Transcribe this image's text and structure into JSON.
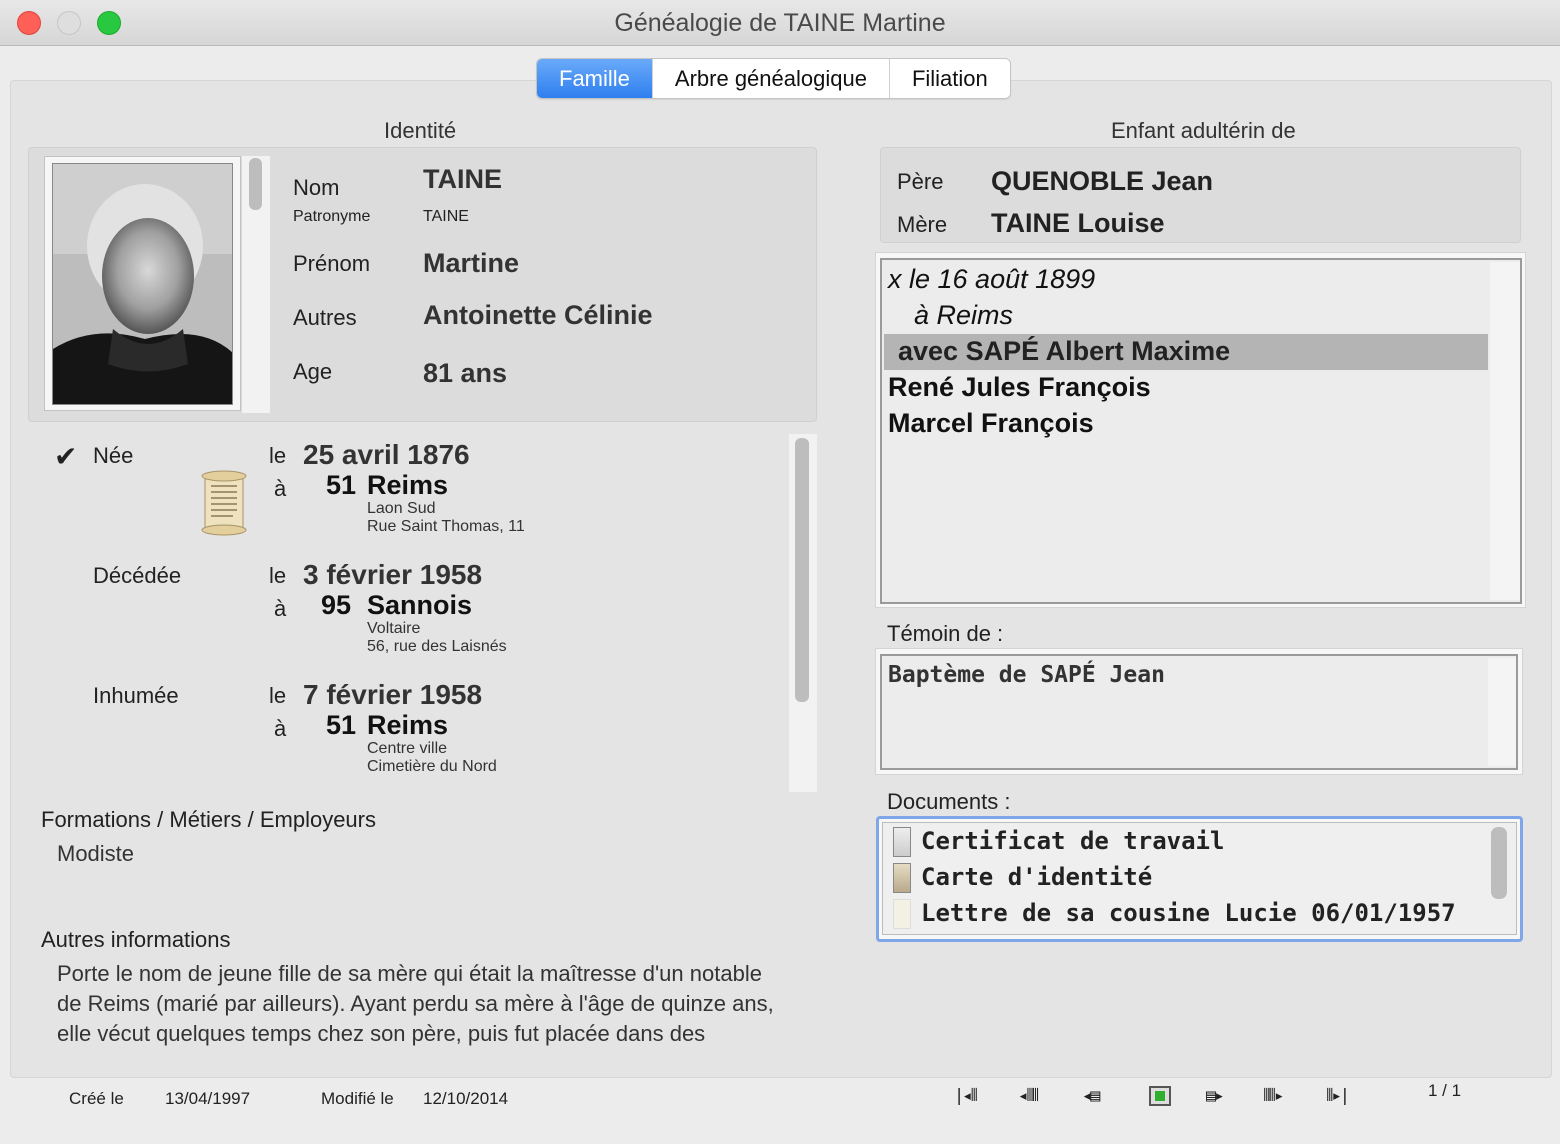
{
  "window": {
    "title": "Généalogie de TAINE Martine",
    "colors": {
      "close": "#fe5f57",
      "minimize": "#dedede",
      "zoom": "#28c840"
    }
  },
  "tabs": [
    {
      "label": "Famille",
      "active": true
    },
    {
      "label": "Arbre généalogique",
      "active": false
    },
    {
      "label": "Filiation",
      "active": false
    }
  ],
  "identity": {
    "heading": "Identité",
    "nom_label": "Nom",
    "nom_value": "TAINE",
    "patronyme_label": "Patronyme",
    "patronyme_value": "TAINE",
    "prenom_label": "Prénom",
    "prenom_value": "Martine",
    "autres_label": "Autres",
    "autres_value": "Antoinette Célinie",
    "age_label": "Age",
    "age_value": "81 ans"
  },
  "events": {
    "check_mark": "✔",
    "birth": {
      "label": "Née",
      "le": "le",
      "date": "25 avril 1876",
      "a": "à",
      "dept": "51",
      "city": "Reims",
      "sub1": "Laon Sud",
      "sub2": "Rue Saint Thomas, 11"
    },
    "death": {
      "label": "Décédée",
      "le": "le",
      "date": "3 février 1958",
      "a": "à",
      "dept": "95",
      "city": "Sannois",
      "sub1": "Voltaire",
      "sub2": "56,  rue des Laisnés"
    },
    "burial": {
      "label": "Inhumée",
      "le": "le",
      "date": "7 février 1958",
      "a": "à",
      "dept": "51",
      "city": "Reims",
      "sub1": "Centre ville",
      "sub2": "Cimetière du Nord"
    }
  },
  "occupations": {
    "heading": "Formations / Métiers / Employeurs",
    "value": "Modiste"
  },
  "other_info": {
    "heading": "Autres informations",
    "lines": [
      "Porte le nom de jeune fille de sa mère qui était la maîtresse d'un notable",
      "de Reims (marié par ailleurs). Ayant perdu sa mère à l'âge de quinze ans,",
      "elle vécut quelques temps chez son père, puis fut placée dans des"
    ]
  },
  "parents": {
    "heading": "Enfant adultérin de",
    "pere_label": "Père",
    "pere_value": "QUENOBLE Jean",
    "mere_label": "Mère",
    "mere_value": "TAINE Louise"
  },
  "unions": {
    "marriage": "x le 16 août 1899",
    "place": "à Reims",
    "spouse": "avec SAPÉ Albert Maxime",
    "children": [
      "René Jules François",
      "Marcel François"
    ]
  },
  "witness": {
    "heading": "Témoin de :",
    "items": [
      "Baptème de SAPÉ Jean"
    ]
  },
  "documents": {
    "heading": "Documents :",
    "items": [
      "Certificat de travail",
      "Carte d'identité",
      "Lettre de sa cousine Lucie 06/01/1957"
    ]
  },
  "footer": {
    "created_label": "Créé le",
    "created_value": "13/04/1997",
    "modified_label": "Modifié le",
    "modified_value": "12/10/2014",
    "page": "1 / 1",
    "nav": [
      "first-icon",
      "prev-fast-icon",
      "prev-icon",
      "current-icon",
      "next-icon",
      "next-fast-icon",
      "last-icon"
    ]
  }
}
